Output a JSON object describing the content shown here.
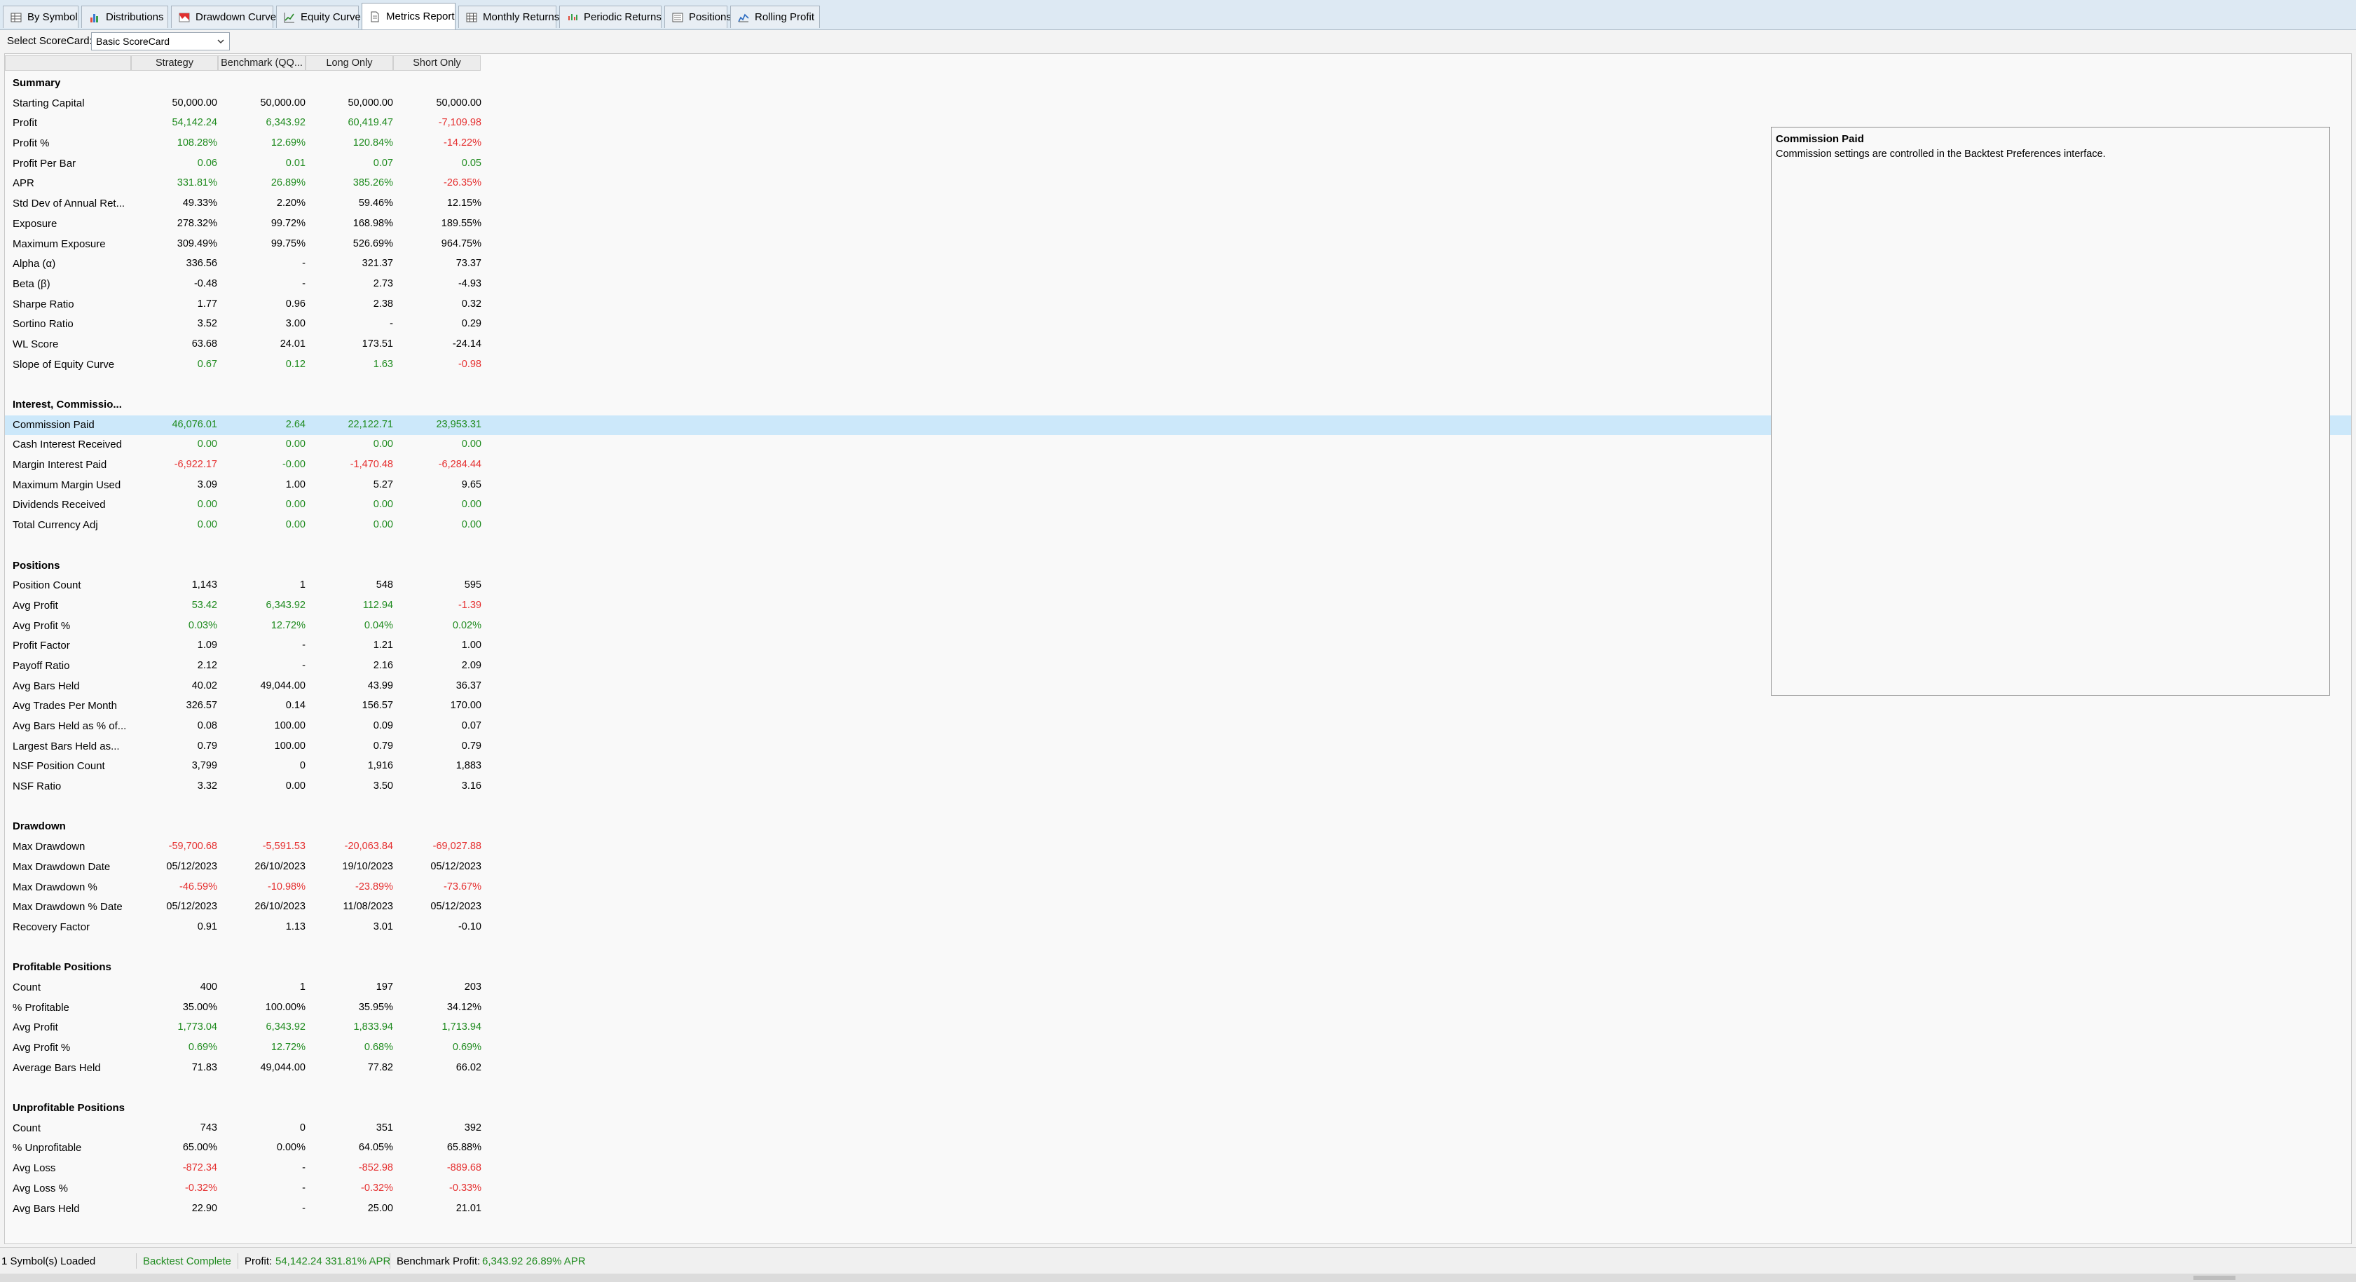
{
  "tabs": [
    {
      "label": "By Symbol",
      "icon": "table-icon"
    },
    {
      "label": "Distributions",
      "icon": "bar-chart-icon"
    },
    {
      "label": "Drawdown Curve",
      "icon": "drawdown-icon"
    },
    {
      "label": "Equity Curve",
      "icon": "line-chart-icon"
    },
    {
      "label": "Metrics Report",
      "icon": "document-icon",
      "active": true
    },
    {
      "label": "Monthly Returns",
      "icon": "grid-icon"
    },
    {
      "label": "Periodic Returns",
      "icon": "periodic-icon"
    },
    {
      "label": "Positions",
      "icon": "list-icon"
    },
    {
      "label": "Rolling Profit",
      "icon": "rolling-icon"
    }
  ],
  "scorecard": {
    "label": "Select ScoreCard:",
    "selected": "Basic ScoreCard"
  },
  "columns": [
    "Strategy",
    "Benchmark (QQ...",
    "Long Only",
    "Short Only"
  ],
  "rows": [
    {
      "type": "section",
      "label": "Summary"
    },
    {
      "label": "Starting Capital",
      "values": [
        "50,000.00",
        "50,000.00",
        "50,000.00",
        "50,000.00"
      ],
      "colors": [
        "neu",
        "neu",
        "neu",
        "neu"
      ]
    },
    {
      "label": "Profit",
      "values": [
        "54,142.24",
        "6,343.92",
        "60,419.47",
        "-7,109.98"
      ],
      "colors": [
        "pos",
        "pos",
        "pos",
        "neg"
      ]
    },
    {
      "label": "Profit %",
      "values": [
        "108.28%",
        "12.69%",
        "120.84%",
        "-14.22%"
      ],
      "colors": [
        "pos",
        "pos",
        "pos",
        "neg"
      ]
    },
    {
      "label": "Profit Per Bar",
      "values": [
        "0.06",
        "0.01",
        "0.07",
        "0.05"
      ],
      "colors": [
        "pos",
        "pos",
        "pos",
        "pos"
      ]
    },
    {
      "label": "APR",
      "values": [
        "331.81%",
        "26.89%",
        "385.26%",
        "-26.35%"
      ],
      "colors": [
        "pos",
        "pos",
        "pos",
        "neg"
      ]
    },
    {
      "label": "Std Dev of Annual Ret...",
      "values": [
        "49.33%",
        "2.20%",
        "59.46%",
        "12.15%"
      ],
      "colors": [
        "neu",
        "neu",
        "neu",
        "neu"
      ]
    },
    {
      "label": "Exposure",
      "values": [
        "278.32%",
        "99.72%",
        "168.98%",
        "189.55%"
      ],
      "colors": [
        "neu",
        "neu",
        "neu",
        "neu"
      ]
    },
    {
      "label": "Maximum Exposure",
      "values": [
        "309.49%",
        "99.75%",
        "526.69%",
        "964.75%"
      ],
      "colors": [
        "neu",
        "neu",
        "neu",
        "neu"
      ]
    },
    {
      "label": "Alpha (α)",
      "values": [
        "336.56",
        "-",
        "321.37",
        "73.37"
      ],
      "colors": [
        "neu",
        "neu",
        "neu",
        "neu"
      ]
    },
    {
      "label": "Beta (β)",
      "values": [
        "-0.48",
        "-",
        "2.73",
        "-4.93"
      ],
      "colors": [
        "neu",
        "neu",
        "neu",
        "neu"
      ]
    },
    {
      "label": "Sharpe Ratio",
      "values": [
        "1.77",
        "0.96",
        "2.38",
        "0.32"
      ],
      "colors": [
        "neu",
        "neu",
        "neu",
        "neu"
      ]
    },
    {
      "label": "Sortino Ratio",
      "values": [
        "3.52",
        "3.00",
        "-",
        "0.29"
      ],
      "colors": [
        "neu",
        "neu",
        "neu",
        "neu"
      ]
    },
    {
      "label": "WL Score",
      "values": [
        "63.68",
        "24.01",
        "173.51",
        "-24.14"
      ],
      "colors": [
        "neu",
        "neu",
        "neu",
        "neu"
      ]
    },
    {
      "label": "Slope of Equity Curve",
      "values": [
        "0.67",
        "0.12",
        "1.63",
        "-0.98"
      ],
      "colors": [
        "pos",
        "pos",
        "pos",
        "neg"
      ]
    },
    {
      "type": "blank"
    },
    {
      "type": "section",
      "label": "Interest, Commissio..."
    },
    {
      "label": "Commission Paid",
      "values": [
        "46,076.01",
        "2.64",
        "22,122.71",
        "23,953.31"
      ],
      "colors": [
        "pos",
        "pos",
        "pos",
        "pos"
      ],
      "selected": true
    },
    {
      "label": "Cash Interest Received",
      "values": [
        "0.00",
        "0.00",
        "0.00",
        "0.00"
      ],
      "colors": [
        "pos",
        "pos",
        "pos",
        "pos"
      ]
    },
    {
      "label": "Margin Interest Paid",
      "values": [
        "-6,922.17",
        "-0.00",
        "-1,470.48",
        "-6,284.44"
      ],
      "colors": [
        "neg",
        "pos",
        "neg",
        "neg"
      ]
    },
    {
      "label": "Maximum Margin Used",
      "values": [
        "3.09",
        "1.00",
        "5.27",
        "9.65"
      ],
      "colors": [
        "neu",
        "neu",
        "neu",
        "neu"
      ]
    },
    {
      "label": "Dividends Received",
      "values": [
        "0.00",
        "0.00",
        "0.00",
        "0.00"
      ],
      "colors": [
        "pos",
        "pos",
        "pos",
        "pos"
      ]
    },
    {
      "label": "Total Currency Adj",
      "values": [
        "0.00",
        "0.00",
        "0.00",
        "0.00"
      ],
      "colors": [
        "pos",
        "pos",
        "pos",
        "pos"
      ]
    },
    {
      "type": "blank"
    },
    {
      "type": "section",
      "label": "Positions"
    },
    {
      "label": "Position Count",
      "values": [
        "1,143",
        "1",
        "548",
        "595"
      ],
      "colors": [
        "neu",
        "neu",
        "neu",
        "neu"
      ]
    },
    {
      "label": "Avg Profit",
      "values": [
        "53.42",
        "6,343.92",
        "112.94",
        "-1.39"
      ],
      "colors": [
        "pos",
        "pos",
        "pos",
        "neg"
      ]
    },
    {
      "label": "Avg Profit %",
      "values": [
        "0.03%",
        "12.72%",
        "0.04%",
        "0.02%"
      ],
      "colors": [
        "pos",
        "pos",
        "pos",
        "pos"
      ]
    },
    {
      "label": "Profit Factor",
      "values": [
        "1.09",
        "-",
        "1.21",
        "1.00"
      ],
      "colors": [
        "neu",
        "neu",
        "neu",
        "neu"
      ]
    },
    {
      "label": "Payoff Ratio",
      "values": [
        "2.12",
        "-",
        "2.16",
        "2.09"
      ],
      "colors": [
        "neu",
        "neu",
        "neu",
        "neu"
      ]
    },
    {
      "label": "Avg Bars Held",
      "values": [
        "40.02",
        "49,044.00",
        "43.99",
        "36.37"
      ],
      "colors": [
        "neu",
        "neu",
        "neu",
        "neu"
      ]
    },
    {
      "label": "Avg Trades Per Month",
      "values": [
        "326.57",
        "0.14",
        "156.57",
        "170.00"
      ],
      "colors": [
        "neu",
        "neu",
        "neu",
        "neu"
      ]
    },
    {
      "label": "Avg Bars Held as % of...",
      "values": [
        "0.08",
        "100.00",
        "0.09",
        "0.07"
      ],
      "colors": [
        "neu",
        "neu",
        "neu",
        "neu"
      ]
    },
    {
      "label": "Largest Bars Held as...",
      "values": [
        "0.79",
        "100.00",
        "0.79",
        "0.79"
      ],
      "colors": [
        "neu",
        "neu",
        "neu",
        "neu"
      ]
    },
    {
      "label": "NSF Position Count",
      "values": [
        "3,799",
        "0",
        "1,916",
        "1,883"
      ],
      "colors": [
        "neu",
        "neu",
        "neu",
        "neu"
      ]
    },
    {
      "label": "NSF Ratio",
      "values": [
        "3.32",
        "0.00",
        "3.50",
        "3.16"
      ],
      "colors": [
        "neu",
        "neu",
        "neu",
        "neu"
      ]
    },
    {
      "type": "blank"
    },
    {
      "type": "section",
      "label": "Drawdown"
    },
    {
      "label": "Max Drawdown",
      "values": [
        "-59,700.68",
        "-5,591.53",
        "-20,063.84",
        "-69,027.88"
      ],
      "colors": [
        "neg",
        "neg",
        "neg",
        "neg"
      ]
    },
    {
      "label": "Max Drawdown Date",
      "values": [
        "05/12/2023",
        "26/10/2023",
        "19/10/2023",
        "05/12/2023"
      ],
      "colors": [
        "neu",
        "neu",
        "neu",
        "neu"
      ]
    },
    {
      "label": "Max Drawdown %",
      "values": [
        "-46.59%",
        "-10.98%",
        "-23.89%",
        "-73.67%"
      ],
      "colors": [
        "neg",
        "neg",
        "neg",
        "neg"
      ]
    },
    {
      "label": "Max Drawdown % Date",
      "values": [
        "05/12/2023",
        "26/10/2023",
        "11/08/2023",
        "05/12/2023"
      ],
      "colors": [
        "neu",
        "neu",
        "neu",
        "neu"
      ]
    },
    {
      "label": "Recovery Factor",
      "values": [
        "0.91",
        "1.13",
        "3.01",
        "-0.10"
      ],
      "colors": [
        "neu",
        "neu",
        "neu",
        "neu"
      ]
    },
    {
      "type": "blank"
    },
    {
      "type": "section",
      "label": "Profitable Positions"
    },
    {
      "label": "Count",
      "values": [
        "400",
        "1",
        "197",
        "203"
      ],
      "colors": [
        "neu",
        "neu",
        "neu",
        "neu"
      ]
    },
    {
      "label": "% Profitable",
      "values": [
        "35.00%",
        "100.00%",
        "35.95%",
        "34.12%"
      ],
      "colors": [
        "neu",
        "neu",
        "neu",
        "neu"
      ]
    },
    {
      "label": "Avg Profit",
      "values": [
        "1,773.04",
        "6,343.92",
        "1,833.94",
        "1,713.94"
      ],
      "colors": [
        "pos",
        "pos",
        "pos",
        "pos"
      ]
    },
    {
      "label": "Avg Profit %",
      "values": [
        "0.69%",
        "12.72%",
        "0.68%",
        "0.69%"
      ],
      "colors": [
        "pos",
        "pos",
        "pos",
        "pos"
      ]
    },
    {
      "label": "Average Bars Held",
      "values": [
        "71.83",
        "49,044.00",
        "77.82",
        "66.02"
      ],
      "colors": [
        "neu",
        "neu",
        "neu",
        "neu"
      ]
    },
    {
      "type": "blank"
    },
    {
      "type": "section",
      "label": "Unprofitable Positions"
    },
    {
      "label": "Count",
      "values": [
        "743",
        "0",
        "351",
        "392"
      ],
      "colors": [
        "neu",
        "neu",
        "neu",
        "neu"
      ]
    },
    {
      "label": "% Unprofitable",
      "values": [
        "65.00%",
        "0.00%",
        "64.05%",
        "65.88%"
      ],
      "colors": [
        "neu",
        "neu",
        "neu",
        "neu"
      ]
    },
    {
      "label": "Avg Loss",
      "values": [
        "-872.34",
        "-",
        "-852.98",
        "-889.68"
      ],
      "colors": [
        "neg",
        "neu",
        "neg",
        "neg"
      ]
    },
    {
      "label": "Avg Loss %",
      "values": [
        "-0.32%",
        "-",
        "-0.32%",
        "-0.33%"
      ],
      "colors": [
        "neg",
        "neu",
        "neg",
        "neg"
      ]
    },
    {
      "label": "Avg Bars Held",
      "values": [
        "22.90",
        "-",
        "25.00",
        "21.01"
      ],
      "colors": [
        "neu",
        "neu",
        "neu",
        "neu"
      ]
    }
  ],
  "info_pane": {
    "title": "Commission Paid",
    "text": "Commission settings are controlled in the Backtest Preferences interface."
  },
  "status": {
    "symbols": "1 Symbol(s) Loaded",
    "backtest": "Backtest Complete",
    "profit_label": "Profit:",
    "profit_value": "54,142.24 331.81% APR",
    "benchmark_label": "Benchmark Profit:",
    "benchmark_value": "6,343.92 26.89% APR"
  },
  "colors": {
    "positive": "#1f8b1f",
    "negative": "#e53030",
    "selected_row": "#cce8fa",
    "tabbar": "#dde9f3"
  }
}
